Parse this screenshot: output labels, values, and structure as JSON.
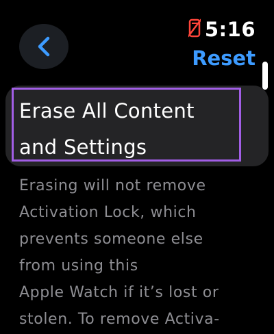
{
  "status": {
    "time": "5:16",
    "phone_icon": "phone-disconnected-icon",
    "phone_icon_color": "#ff453a"
  },
  "nav": {
    "back_icon": "chevron-left-icon",
    "reset_label": "Reset"
  },
  "setting": {
    "title_line1": "Erase All Content",
    "title_line2": "and Settings",
    "description_lines": [
      "Erasing will not remove",
      "Activation Lock, which",
      "prevents someone else",
      "from using this",
      "Apple Watch if it’s lost or",
      "stolen. To remove Activa-"
    ]
  },
  "colors": {
    "accent": "#3d9bff",
    "highlight_border": "#a25ee6",
    "card_background": "#242426",
    "secondary_text": "#8e8e93"
  }
}
